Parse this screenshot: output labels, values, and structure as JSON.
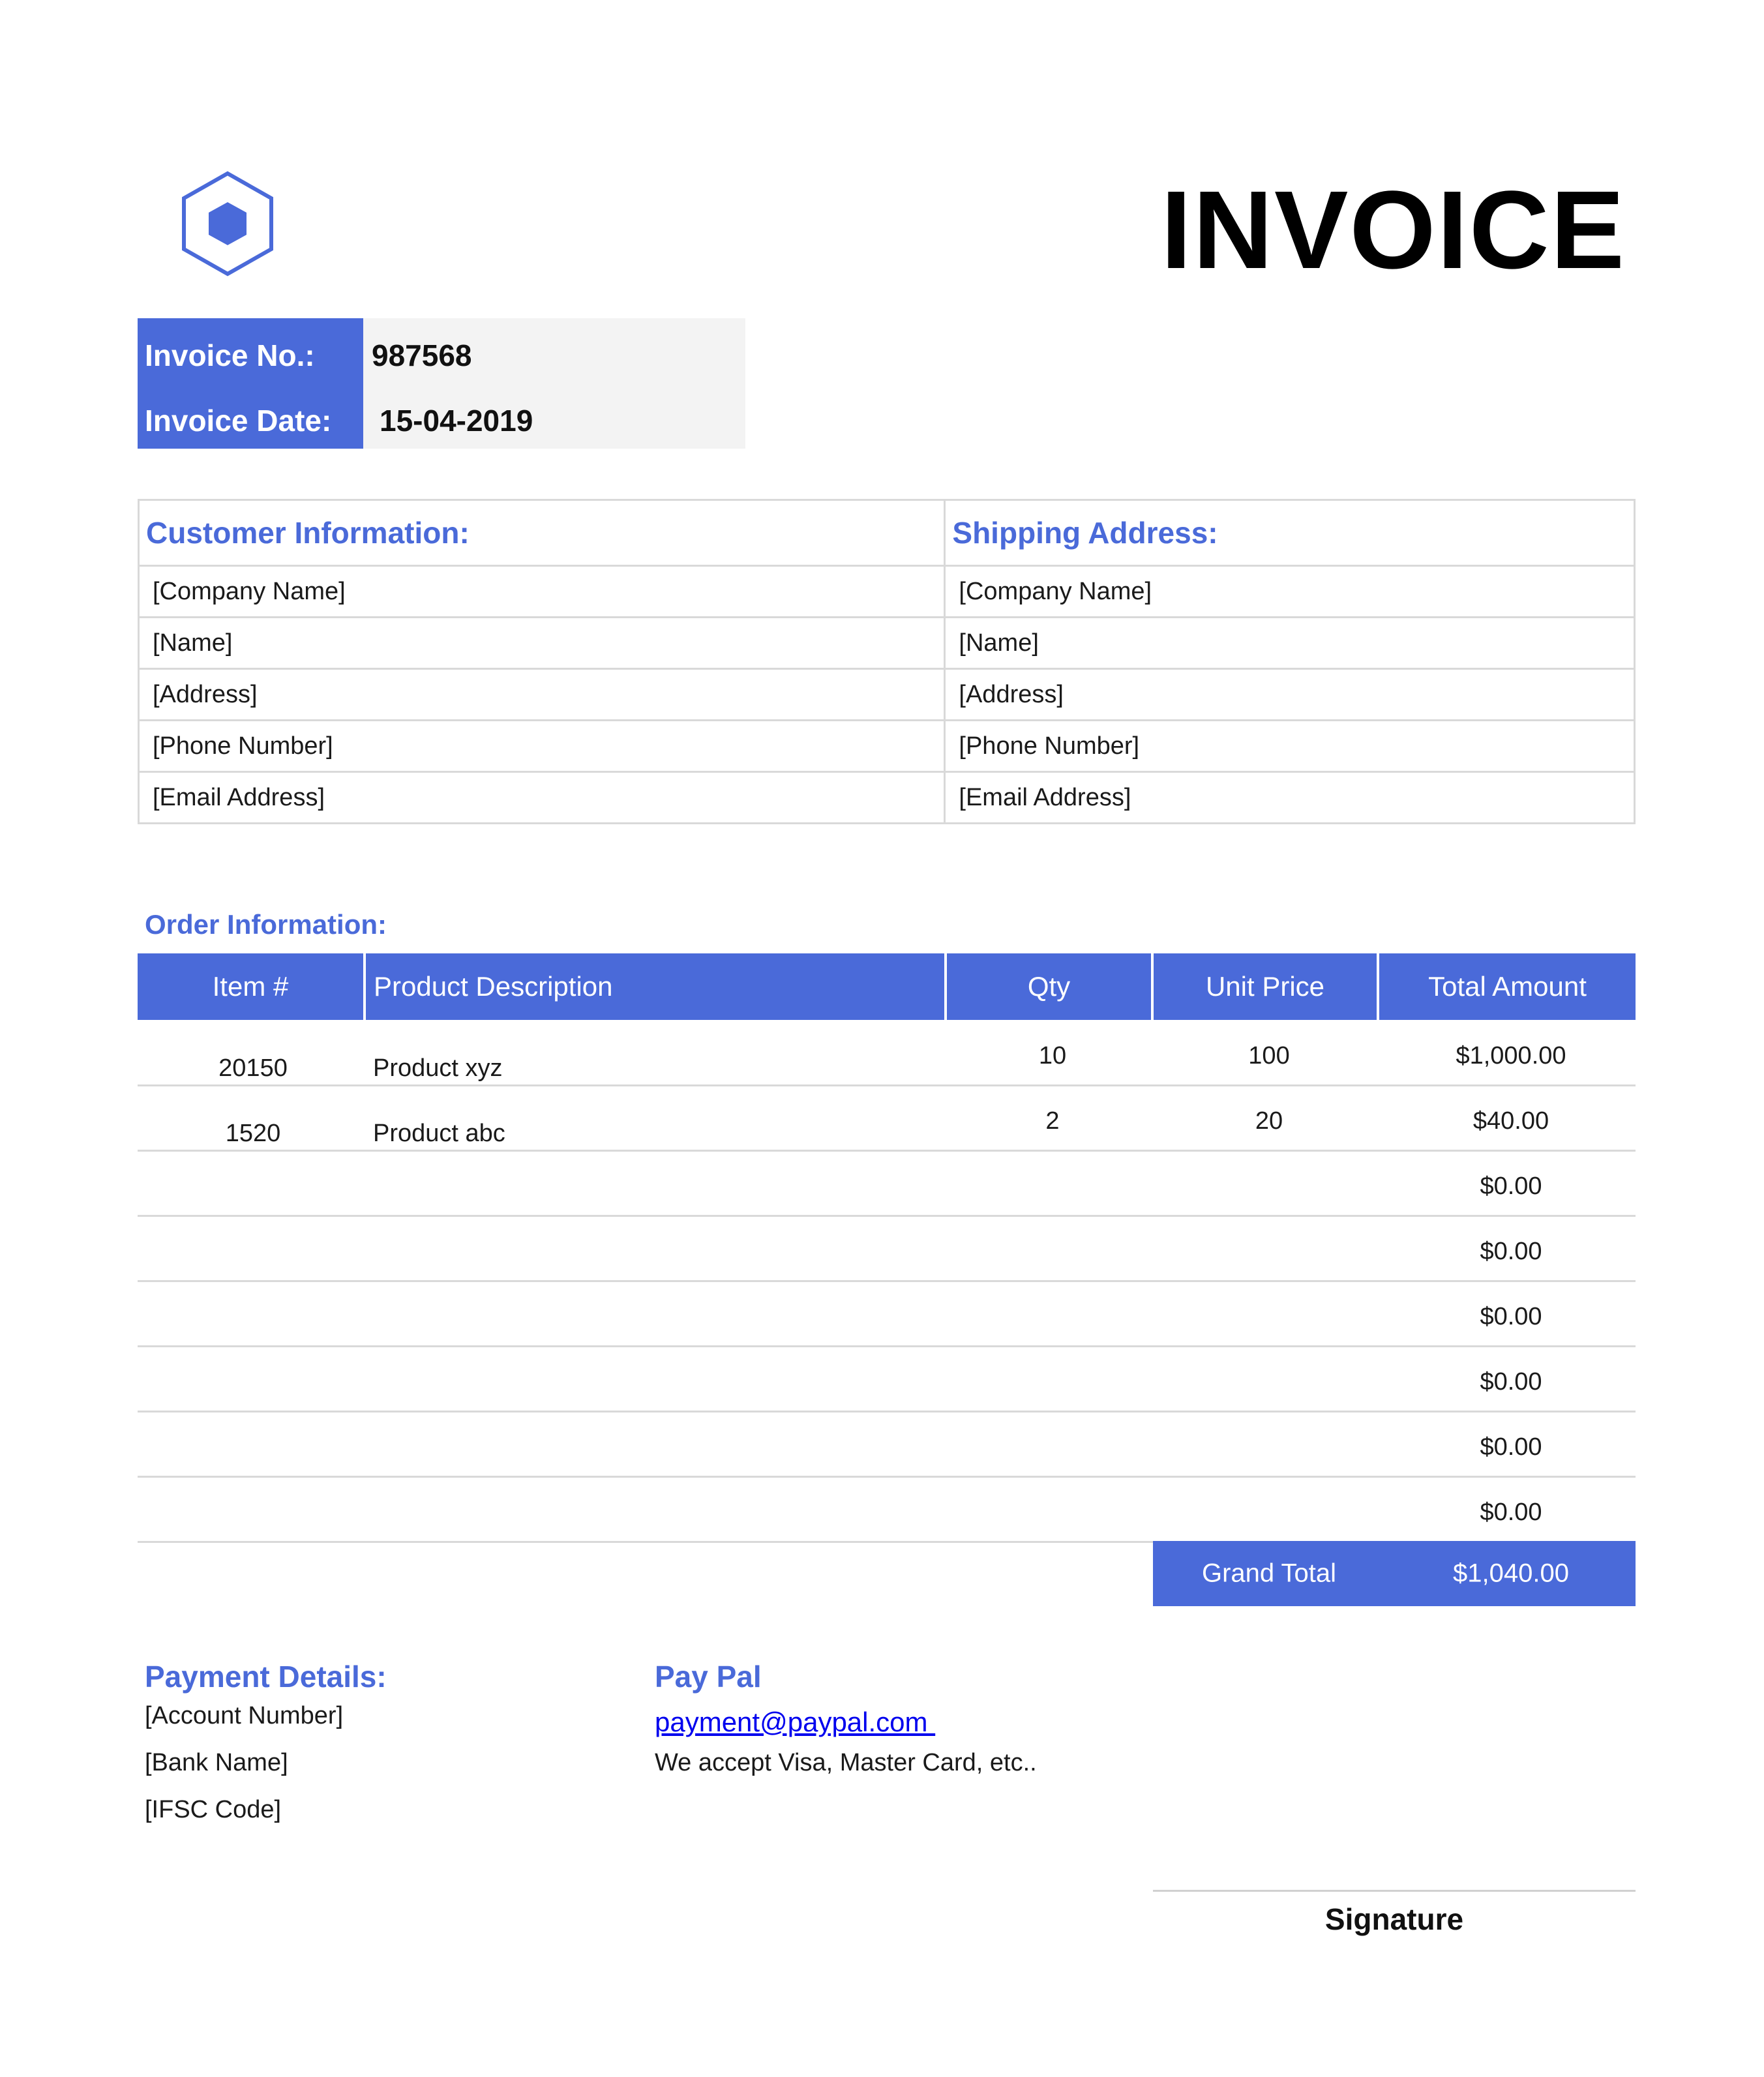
{
  "brand": {
    "accent_color": "#4a6ad9",
    "logo_icon": "hexagon-logo-icon"
  },
  "title": "INVOICE",
  "meta": {
    "invoice_no_label": "Invoice No.:",
    "invoice_no_value": "987568",
    "invoice_date_label": "Invoice Date:",
    "invoice_date_value": "15-04-2019"
  },
  "customer": {
    "heading": "Customer Information:",
    "rows": [
      "[Company Name]",
      "[Name]",
      "[Address]",
      "[Phone Number]",
      "[Email Address]"
    ]
  },
  "shipping": {
    "heading": "Shipping Address:",
    "rows": [
      "[Company Name]",
      "[Name]",
      "[Address]",
      "[Phone Number]",
      "[Email Address]"
    ]
  },
  "order": {
    "heading": "Order Information:",
    "columns": [
      "Item #",
      "Product Description",
      "Qty",
      "Unit Price",
      "Total Amount"
    ],
    "rows": [
      {
        "item": "20150",
        "description": "Product xyz",
        "qty": "10",
        "unit_price": "100",
        "total": "$1,000.00"
      },
      {
        "item": "1520",
        "description": "Product abc",
        "qty": "2",
        "unit_price": "20",
        "total": "$40.00"
      },
      {
        "item": "",
        "description": "",
        "qty": "",
        "unit_price": "",
        "total": "$0.00"
      },
      {
        "item": "",
        "description": "",
        "qty": "",
        "unit_price": "",
        "total": "$0.00"
      },
      {
        "item": "",
        "description": "",
        "qty": "",
        "unit_price": "",
        "total": "$0.00"
      },
      {
        "item": "",
        "description": "",
        "qty": "",
        "unit_price": "",
        "total": "$0.00"
      },
      {
        "item": "",
        "description": "",
        "qty": "",
        "unit_price": "",
        "total": "$0.00"
      },
      {
        "item": "",
        "description": "",
        "qty": "",
        "unit_price": "",
        "total": "$0.00"
      }
    ],
    "grand_total_label": "Grand Total",
    "grand_total_value": "$1,040.00"
  },
  "payment": {
    "heading": "Payment Details:",
    "lines": [
      "[Account Number]",
      "[Bank Name]",
      "[IFSC Code]"
    ]
  },
  "paypal": {
    "heading": "Pay Pal",
    "email": "payment@paypal.com ",
    "note": "We accept Visa, Master Card, etc.."
  },
  "signature_label": "Signature"
}
